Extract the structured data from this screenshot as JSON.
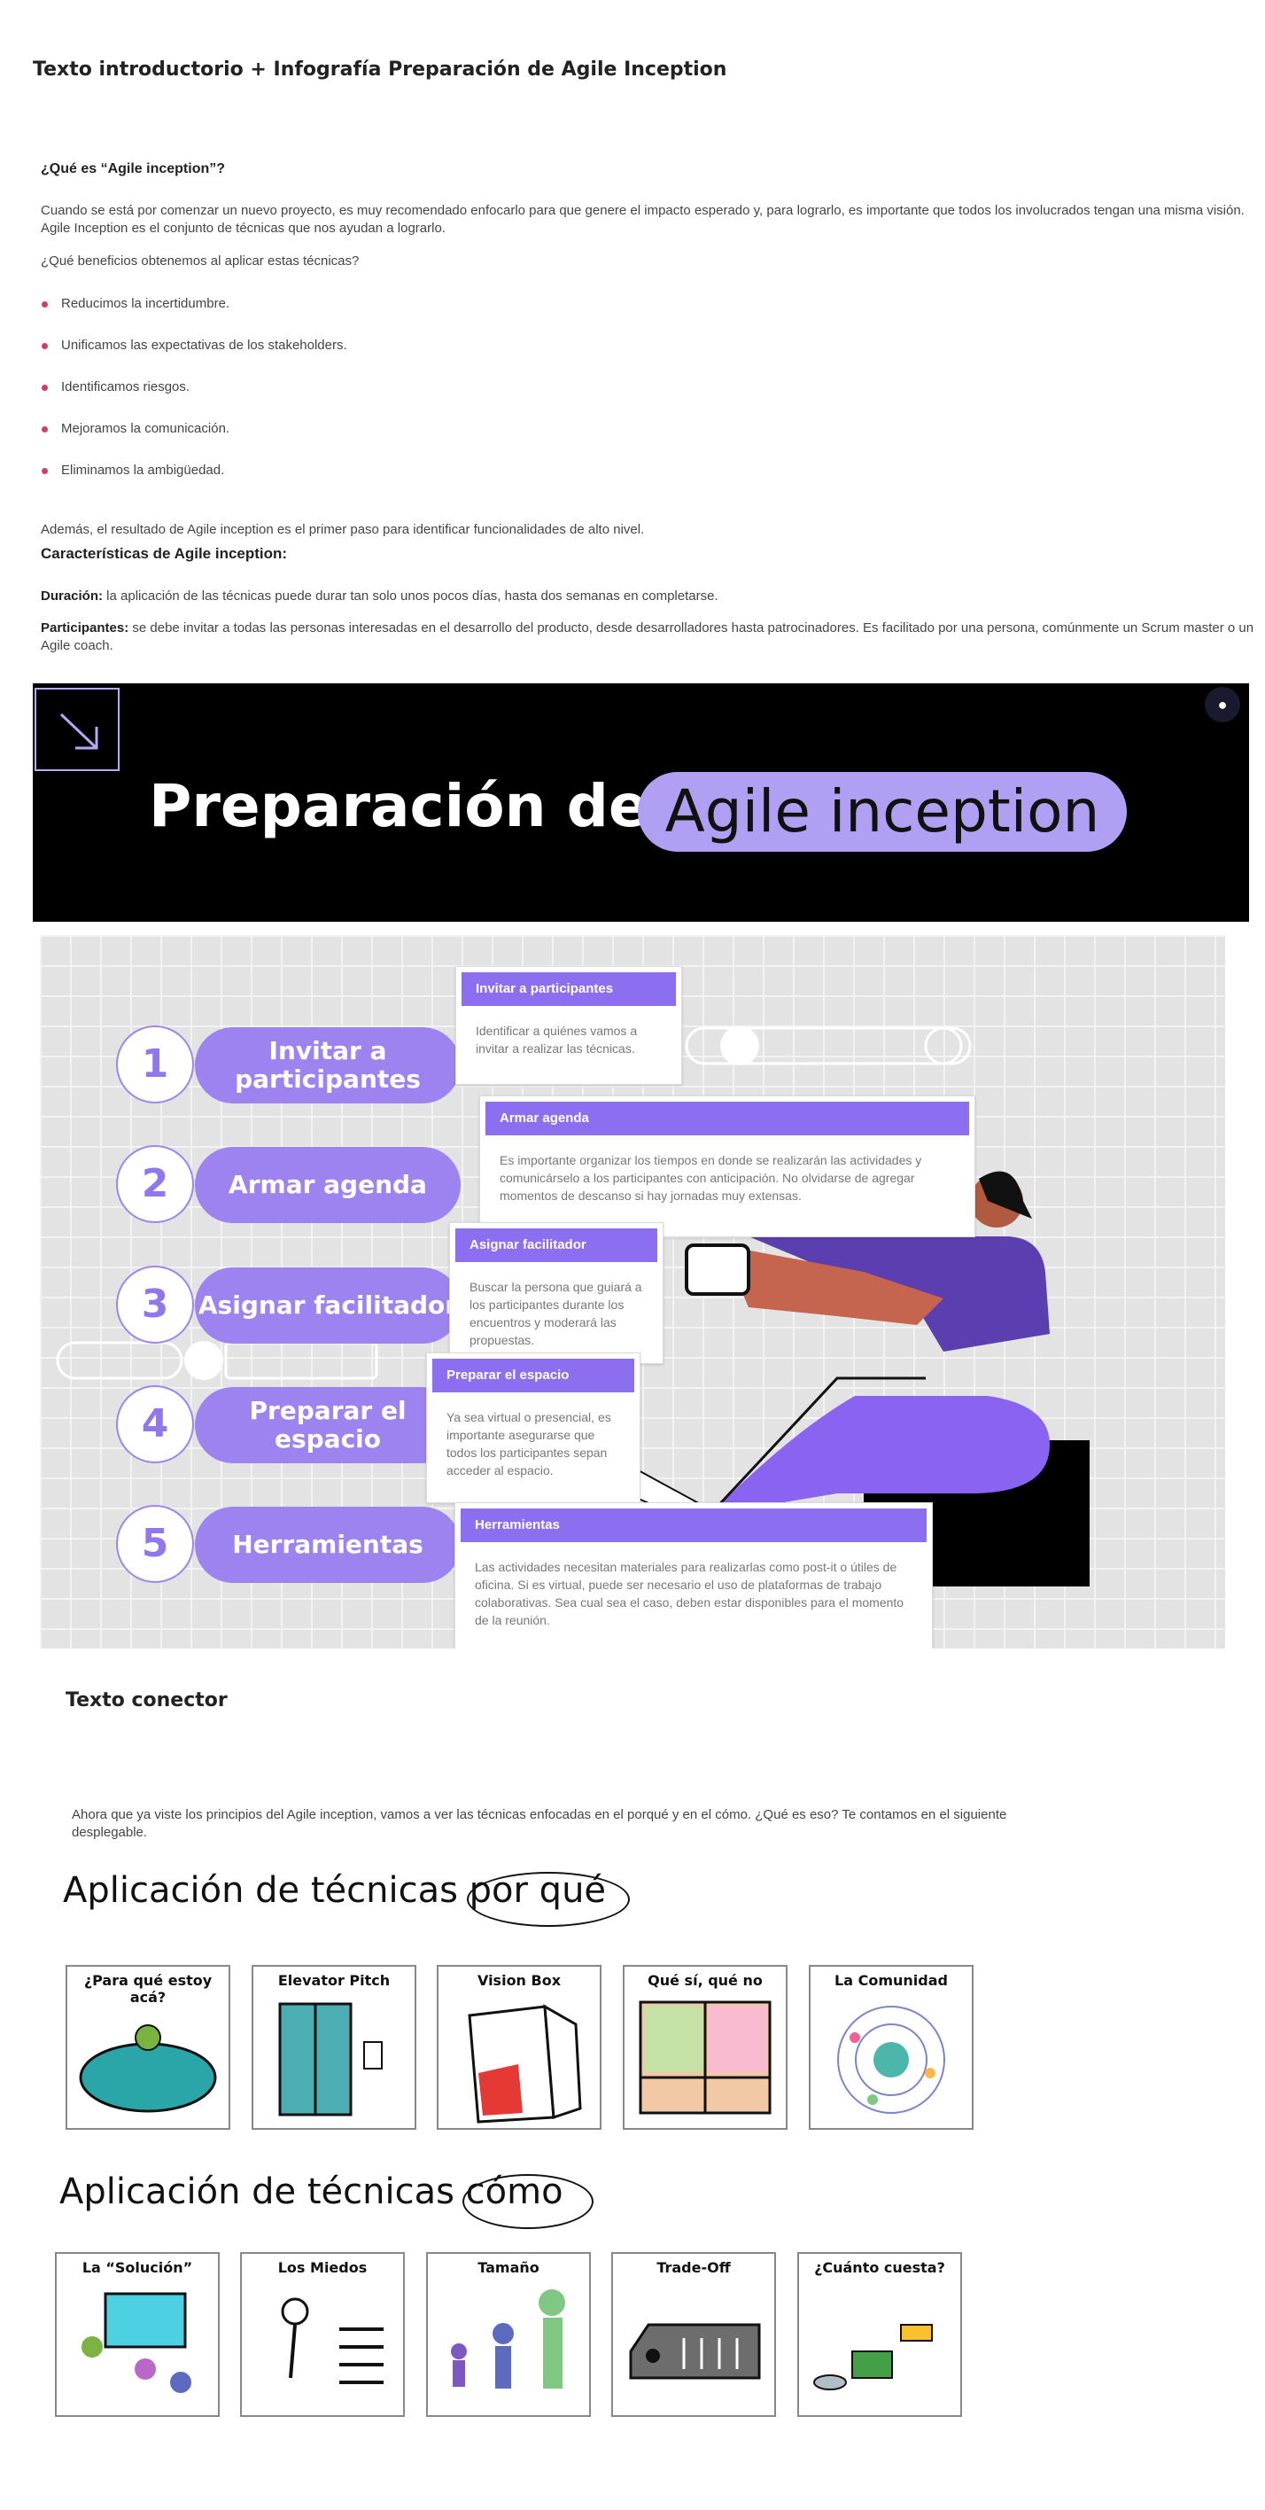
{
  "page_title": "Texto introductorio + Infografía Preparación de Agile Inception",
  "intro": {
    "question": "¿Qué es “Agile inception”?",
    "paragraph1": "Cuando se está por comenzar un nuevo proyecto, es muy recomendado enfocarlo para que genere el impacto esperado y, para lograrlo, es importante que todos los involucrados tengan una misma visión.",
    "paragraph1b": "Agile Inception es el conjunto de técnicas que nos ayudan a lograrlo.",
    "benefits_question": "¿Qué beneficios obtenemos al aplicar estas técnicas?",
    "benefits": [
      "Reducimos la incertidumbre.",
      "Unificamos las expectativas de los stakeholders.",
      "Identificamos riesgos.",
      "Mejoramos la comunicación.",
      "Eliminamos la ambigüedad."
    ],
    "result": "Además, el resultado de Agile inception es el primer paso para identificar funcionalidades de alto nivel.",
    "characteristics_title": "Características de Agile inception:",
    "duration_label": "Duración:",
    "duration_text": " la aplicación de las técnicas puede durar tan solo unos pocos días, hasta dos semanas en completarse.",
    "participants_label": "Participantes:",
    "participants_text": " se debe invitar a todas las personas interesadas en el desarrollo del producto, desde desarrolladores hasta patrocinadores. Es facilitado por una persona, comúnmente un Scrum master o un",
    "participants_text2": "Agile coach."
  },
  "banner": {
    "title_part1": "Preparación del",
    "title_part2": "Agile inception",
    "accessibility_icon": "accessibility-icon",
    "arrow_icon": "arrow-down-right-icon"
  },
  "infographic": {
    "steps": [
      {
        "number": "1",
        "label": "Invitar a participantes"
      },
      {
        "number": "2",
        "label": "Armar agenda"
      },
      {
        "number": "3",
        "label": "Asignar facilitador"
      },
      {
        "number": "4",
        "label": "Preparar el espacio"
      },
      {
        "number": "5",
        "label": "Herramientas"
      }
    ],
    "cards": [
      {
        "title": "Invitar a participantes",
        "body": "Identificar a quiénes vamos a invitar a realizar las técnicas."
      },
      {
        "title": "Armar agenda",
        "body": "Es importante organizar los tiempos en donde se realizarán las actividades y comunicárselo a los participantes con anticipación. No olvidarse de agregar momentos de descanso si hay jornadas muy extensas."
      },
      {
        "title": "Asignar facilitador",
        "body": "Buscar la persona que guiará a los participantes durante los encuentros y moderará las propuestas."
      },
      {
        "title": "Preparar el espacio",
        "body": "Ya sea virtual o presencial, es importante asegurarse que todos los participantes sepan acceder al espacio."
      },
      {
        "title": "Herramientas",
        "body": "Las actividades necesitan materiales para realizarlas como post-it o útiles de oficina. Si es virtual, puede ser necesario el uso de plataformas de trabajo colaborativas. Sea cual sea el caso, deben estar disponibles para el momento de la reunión."
      }
    ]
  },
  "connector": {
    "title": "Texto conector",
    "text1": "Ahora que ya viste los principios del Agile inception, vamos a ver las técnicas enfocadas en el porqué y en el cómo. ¿Qué es eso? Te contamos en el siguiente",
    "text2": "desplegable."
  },
  "techniques_why": {
    "title_prefix": "Aplicación de técnicas",
    "title_emph": "por qué",
    "cards": [
      "¿Para qué estoy acá?",
      "Elevator Pitch",
      "Vision Box",
      "Qué sí, qué no",
      "La Comunidad"
    ]
  },
  "techniques_how": {
    "title_prefix": "Aplicación de técnicas",
    "title_emph": "cómo",
    "cards": [
      "La “Solución”",
      "Los Miedos",
      "Tamaño",
      "Trade-Off",
      "¿Cuánto cuesta?"
    ]
  },
  "colors": {
    "accent_purple": "#9d83f0",
    "card_header": "#8b6ff0",
    "bullet": "#d33a6e",
    "banner_bg": "#000000"
  }
}
